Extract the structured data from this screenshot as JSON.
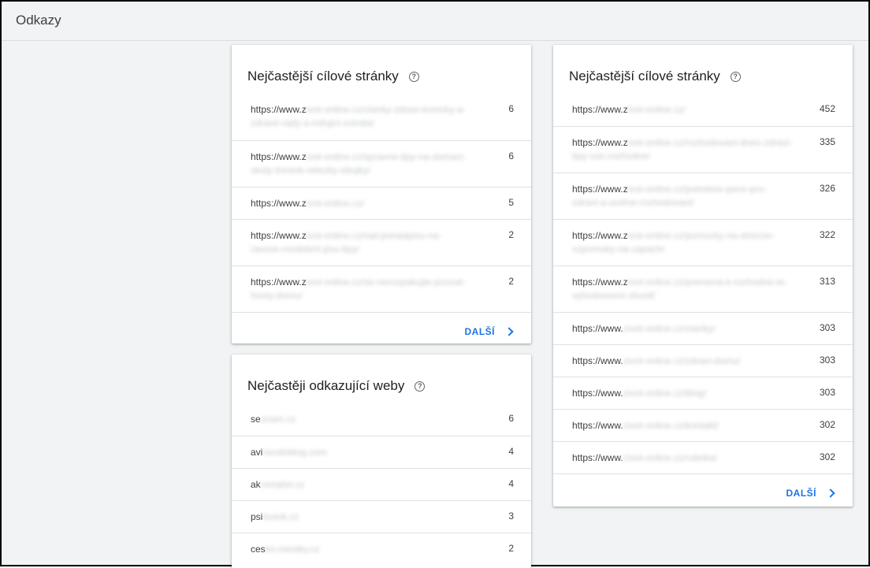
{
  "header": {
    "title": "Odkazy"
  },
  "cards": {
    "top_targets_left": {
      "title": "Nejčastější cílové stránky",
      "rows": [
        {
          "url_visible": "https://www.z",
          "url_blurred": "ivot-online.cz/clanky-zdravi-konicky-a-zdrave-rady-a-milujici-zvirata/",
          "count": "6"
        },
        {
          "url_visible": "https://www.z",
          "url_blurred": "ivot-online.cz/spravne-tipy-na-domaci-skoly-trenink-retezky-obojky/",
          "count": "6"
        },
        {
          "url_visible": "https://www.z",
          "url_blurred": "ivot-online.cz/",
          "count": "5"
        },
        {
          "url_visible": "https://www.z",
          "url_blurred": "ivot-online.cz/rad-ponadpisu-na-rasove-rozdeleni-psu-tipy/",
          "count": "2"
        },
        {
          "url_visible": "https://www.z",
          "url_blurred": "ivot-online.cz/se-nerozpakujte-pozvat-hosty-domu/",
          "count": "2"
        }
      ],
      "more_label": "DALŠÍ"
    },
    "top_linking_sites": {
      "title": "Nejčastěji odkazující weby",
      "rows": [
        {
          "site_visible": "se",
          "site_blurred": "znam.cz",
          "count": "6"
        },
        {
          "site_visible": "avi",
          "site_blurred": "nevdoblog.com",
          "count": "4"
        },
        {
          "site_visible": "ak",
          "site_blurred": "cenalist.cz",
          "count": "4"
        },
        {
          "site_visible": "psi",
          "site_blurred": "lovink.cz",
          "count": "3"
        },
        {
          "site_visible": "ces",
          "site_blurred": "ko-mestky.cz",
          "count": "2"
        }
      ]
    },
    "top_targets_right": {
      "title": "Nejčastější cílové stránky",
      "rows": [
        {
          "url_visible": "https://www.z",
          "url_blurred": "ivot-online.cz/",
          "count": "452",
          "tall": false
        },
        {
          "url_visible": "https://www.z",
          "url_blurred": "ivot-online.cz/rozhodovani-dnes-zdravi-tipy-vas-rozhodne/",
          "count": "335",
          "tall": true
        },
        {
          "url_visible": "https://www.z",
          "url_blurred": "ivot-online.cz/potrebne-pece-pro-zdravi-a-ucelne-rozhodovani/",
          "count": "326",
          "tall": true
        },
        {
          "url_visible": "https://www.z",
          "url_blurred": "ivot-online.cz/pomucky-na-strecne-vzpomuky-na-zapach/",
          "count": "322",
          "tall": true
        },
        {
          "url_visible": "https://www.z",
          "url_blurred": "ivot-online.cz/premena-k-rozhodne-te-vyhodnoceni-zkusit/",
          "count": "313",
          "tall": true
        },
        {
          "url_visible": "https://www.",
          "url_blurred": "zivot-online.cz/clanky/",
          "count": "303",
          "tall": false
        },
        {
          "url_visible": "https://www.",
          "url_blurred": "zivot-online.cz/zdravi-domu/",
          "count": "303",
          "tall": false
        },
        {
          "url_visible": "https://www.",
          "url_blurred": "zivot-online.cz/blog/",
          "count": "303",
          "tall": false
        },
        {
          "url_visible": "https://www.",
          "url_blurred": "zivot-online.cz/kontakt/",
          "count": "302",
          "tall": false
        },
        {
          "url_visible": "https://www.",
          "url_blurred": "zivot-online.cz/rubrika/",
          "count": "302",
          "tall": false
        }
      ],
      "more_label": "DALŠÍ"
    }
  },
  "icons": {
    "help": "help-circle-icon",
    "more": "chevron-right-icon"
  },
  "colors": {
    "background": "#f1f3f4",
    "card": "#ffffff",
    "link": "#1a73e8",
    "divider": "#e0e0e0"
  }
}
